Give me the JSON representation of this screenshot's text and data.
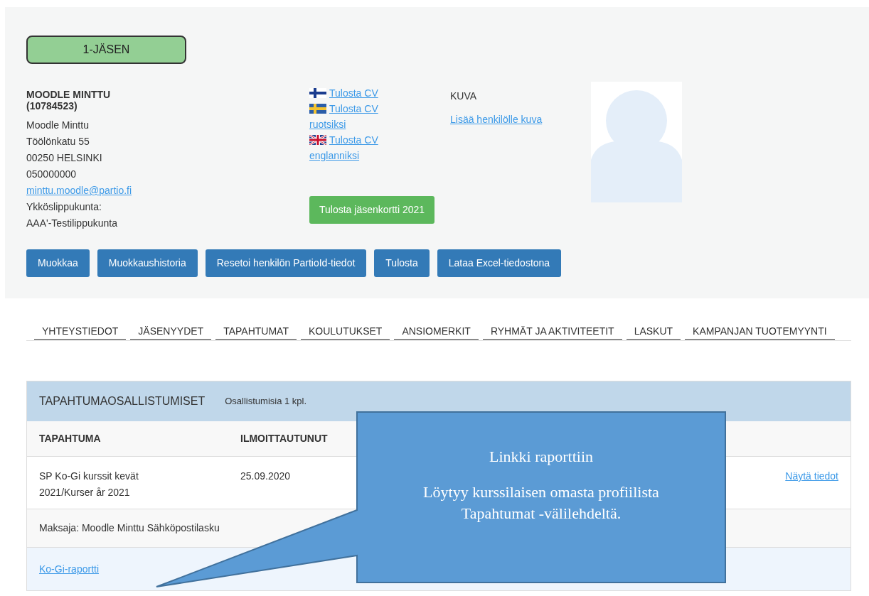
{
  "membership_badge": "1-JÄSEN",
  "person": {
    "name": "MOODLE MINTTU",
    "id": "(10784523)",
    "lines": [
      "Moodle Minttu",
      "Töölönkatu 55",
      "00250 HELSINKI",
      "050000000"
    ],
    "email": "minttu.moodle@partio.fi",
    "unit_label": "Ykköslippukunta:",
    "unit": "AAA'-Testilippukunta"
  },
  "cv_links": [
    {
      "kind": "fi",
      "label": "Tulosta CV"
    },
    {
      "kind": "se",
      "label": "Tulosta CV ruotsiksi"
    },
    {
      "kind": "gb",
      "label": "Tulosta CV englanniksi"
    }
  ],
  "print_card_button": "Tulosta jäsenkortti 2021",
  "photo": {
    "heading": "KUVA",
    "add_link": "Lisää henkilölle kuva"
  },
  "actions": [
    "Muokkaa",
    "Muokkaushistoria",
    "Resetoi henkilön PartioId-tiedot",
    "Tulosta",
    "Lataa Excel-tiedostona"
  ],
  "tabs": [
    "YHTEYSTIEDOT",
    "JÄSENYYDET",
    "TAPAHTUMAT",
    "KOULUTUKSET",
    "ANSIOMERKIT",
    "RYHMÄT JA AKTIVITEETIT",
    "LASKUT",
    "KAMPANJAN TUOTEMYYNTI"
  ],
  "panel": {
    "title": "TAPAHTUMAOSALLISTUMISET",
    "count": "Osallistumisia 1 kpl.",
    "columns": [
      "TAPAHTUMA",
      "ILMOITTAUTUNUT"
    ],
    "rows": [
      {
        "cells": [
          "SP Ko-Gi kurssit kevät 2021/Kurser år 2021",
          "25.09.2020"
        ],
        "action": "Näytä tiedot"
      }
    ],
    "payer": "Maksaja: Moodle Minttu Sähköpostilasku",
    "report_link": "Ko-Gi-raportti"
  },
  "callout": {
    "title": "Linkki raporttiin",
    "body": "Löytyy kurssilaisen omasta profiilista Tapahtumat -välilehdeltä."
  }
}
